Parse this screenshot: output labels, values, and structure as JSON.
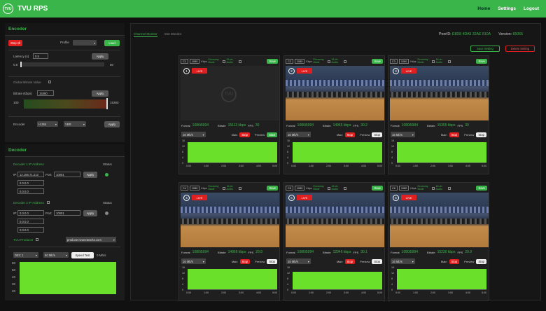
{
  "app": {
    "logo_text": "TVU",
    "title": "TVU RPS"
  },
  "nav": {
    "home": "Home",
    "settings": "Settings",
    "logout": "Logout"
  },
  "encoder": {
    "title": "Encoder",
    "stop_all": "Stop All",
    "profile_label": "Profile",
    "load": "Load",
    "latency_label": "Latency (s)",
    "latency_value": "0.5",
    "apply": "Apply",
    "latency_min": "0.5",
    "latency_max": "50",
    "global_bitrate_label": "Global Bitrate Value",
    "bitrate_label": "Bitrate (kbps)",
    "bitrate_value": "15360",
    "bitrate_min": "100",
    "bitrate_max": "15360",
    "encoder_label": "Encoder",
    "codec": "H.264",
    "rate_mode": "VBR"
  },
  "decoder": {
    "title": "Decoder",
    "ip1_label": "Decoder 1 IP Address",
    "status_label": "Status",
    "ip_prefix": "IP:",
    "ip1_value": "12.156.71.213",
    "port_label": "Port:",
    "port1_value": "10001",
    "ip1_extra1": "0.0.0.0",
    "ip1_extra2": "0.0.0.0",
    "ip2_label": "Decoder 2 IP Address",
    "ip2_value": "0.0.0.0",
    "port2_value": "10001",
    "ip2_extra1": "0.0.0.0",
    "ip2_extra2": "0.0.0.0",
    "producer_label": "TVU Producer",
    "producer_value": "producer.tvunetworks.com",
    "dec_select": "DEC 1",
    "rate_select": "60 Mb/s",
    "speed_test": "Speed Test",
    "speed_value": "0 Mb/s",
    "y_ticks": [
      "60",
      "50",
      "40",
      "30",
      "20"
    ]
  },
  "main": {
    "tabs": [
      "Channel Monitor",
      "Slot Monitor"
    ],
    "peer_id_label": "PeerID:",
    "peer_id": "E8D8 4DA5 32AE 810A",
    "version_label": "Version:",
    "version": "65066",
    "save_setting": "Save Setting",
    "delete_setting": "Delete Setting"
  },
  "card_labels": {
    "resolution": "1080",
    "kbps": "Kbps",
    "economy": "Economy Mode",
    "audio": "16-ch. Audio",
    "save": "Save",
    "live": "LIVE",
    "format_label": "Format",
    "bitrate_label": "Bitrate",
    "fps_label": "FPS",
    "main_label": "Main",
    "preview_label": "Preview",
    "stop": "Stop",
    "start": "Start",
    "y_ticks": [
      "16",
      "12",
      "8",
      "4",
      "0"
    ],
    "x_ticks": [
      "0:00",
      "1:00",
      "2:00",
      "3:00",
      "4:00",
      "5:00"
    ],
    "logo": "TVU"
  },
  "channels": [
    {
      "id": "C1",
      "format": "1080i5994",
      "bitrate": "15113 kbps",
      "fps": "30",
      "speed": "16 Mb/s",
      "active": false,
      "preview": "Start",
      "fill": 0.92
    },
    {
      "id": "C2",
      "format": "1080i5994",
      "bitrate": "14965 kbps",
      "fps": "30.2",
      "speed": "16 Mb/s",
      "active": true,
      "preview": "Stop",
      "fill": 0.92
    },
    {
      "id": "C3",
      "format": "1080i5994",
      "bitrate": "15355 kbps",
      "fps": "30",
      "speed": "16 Mb/s",
      "active": true,
      "preview": "Stop",
      "fill": 0.92
    },
    {
      "id": "C4",
      "format": "1080i5994",
      "bitrate": "14866 kbps",
      "fps": "29.9",
      "speed": "16 Mb/s",
      "active": true,
      "preview": "Stop",
      "fill": 0.92
    },
    {
      "id": "C5",
      "format": "1080i5994",
      "bitrate": "12946 kbps",
      "fps": "30.1",
      "speed": "16 Mb/s",
      "active": true,
      "preview": "Stop",
      "fill": 0.82
    },
    {
      "id": "C6",
      "format": "1080i5994",
      "bitrate": "15230 kbps",
      "fps": "29.9",
      "speed": "16 Mb/s",
      "active": true,
      "preview": "Stop",
      "fill": 0.92
    }
  ]
}
